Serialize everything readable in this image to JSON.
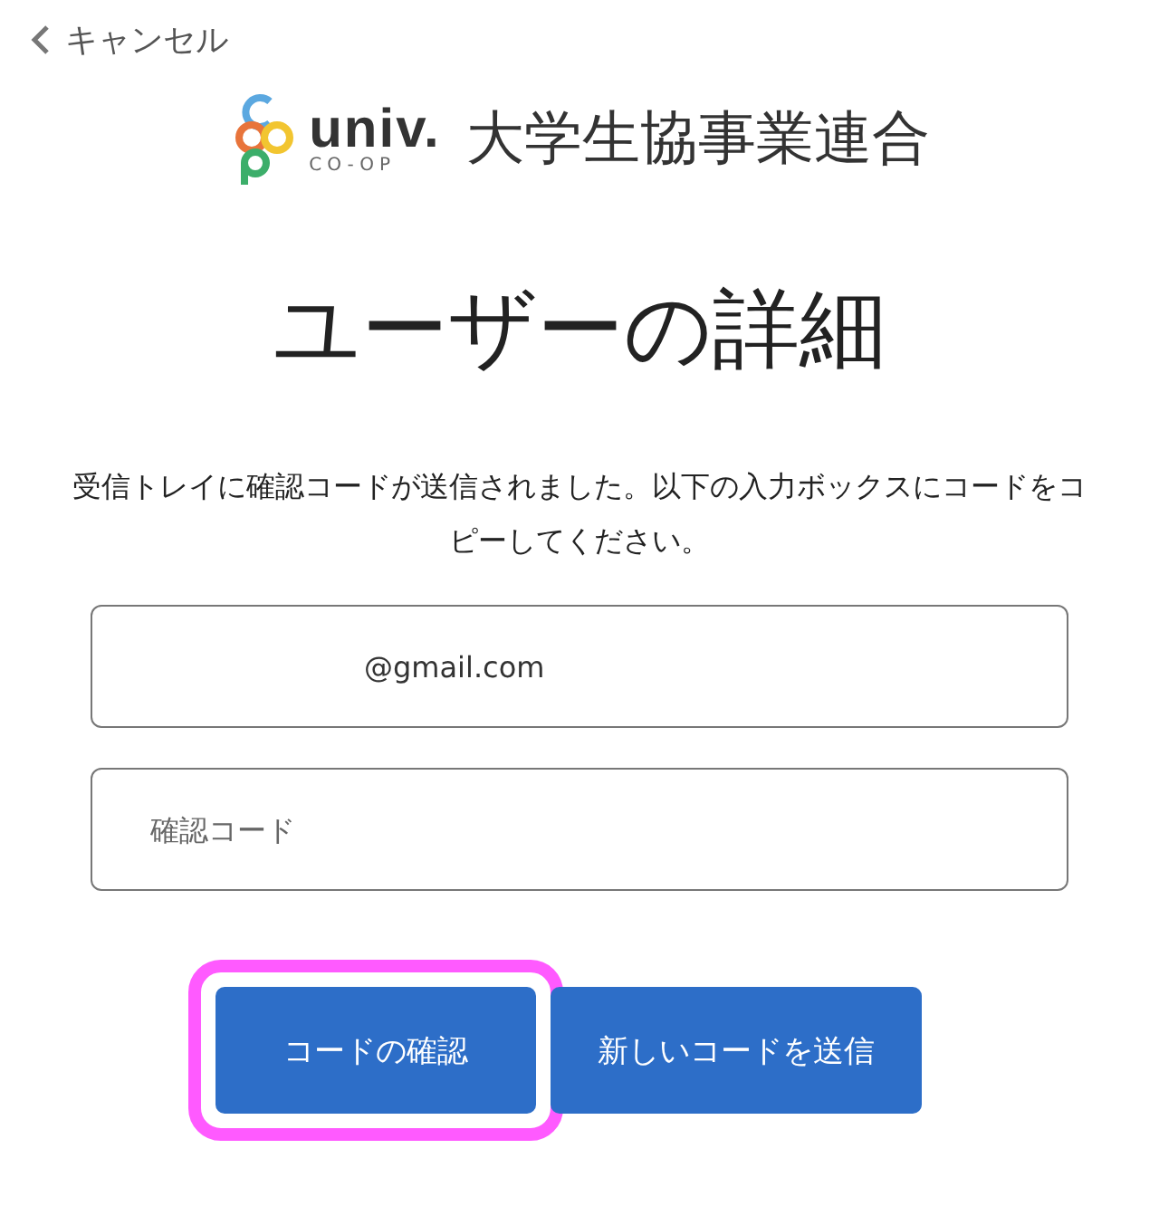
{
  "cancel": {
    "label": "キャンセル"
  },
  "logo": {
    "brand": "univ.",
    "subbrand": "CO-OP",
    "org": "大学生協事業連合"
  },
  "title": "ユーザーの詳細",
  "message": "受信トレイに確認コードが送信されました。以下の入力ボックスにコードをコピーしてください。",
  "email_field": {
    "value": "@gmail.com"
  },
  "code_field": {
    "placeholder": "確認コード"
  },
  "buttons": [
    {
      "label": "コードの確認",
      "highlighted": true
    },
    {
      "label": "新しいコードを送信",
      "highlighted": false
    }
  ]
}
